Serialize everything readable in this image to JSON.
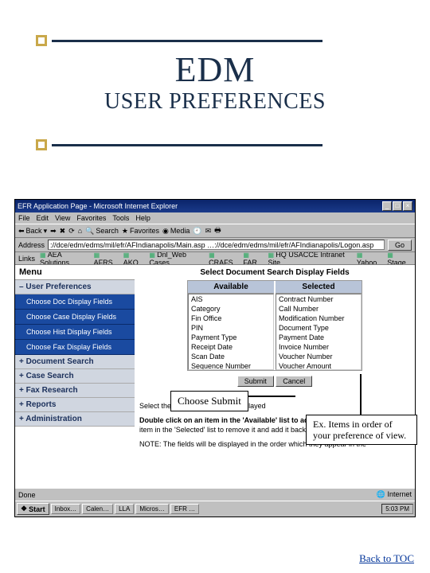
{
  "slide": {
    "title_main": "EDM",
    "title_sub": "USER PREFERENCES",
    "back_link": "Back to TOC"
  },
  "browser": {
    "window_title": "EFR Application Page - Microsoft Internet Explorer",
    "menus": [
      "File",
      "Edit",
      "View",
      "Favorites",
      "Tools",
      "Help"
    ],
    "toolbar": {
      "back": "Back",
      "search": "Search",
      "favorites": "Favorites",
      "media": "Media"
    },
    "address_label": "Address",
    "address_value": "://dce/edm/edms/mil/efr/AFIndianapolis/Main.asp …://dce/edm/edms/mil/efr/AFIndianapolis/Logon.asp",
    "go_label": "Go",
    "links_label": "Links",
    "links": [
      "AEA Solutions",
      "AFRS",
      "AKO",
      "Dnl_Web Cases",
      "CRAFS",
      "FAR",
      "HQ USACCE Intranet Site",
      "Yahoo",
      "Stage"
    ],
    "status_done": "Done",
    "status_zone": "Internet"
  },
  "sidebar": {
    "menu_header": "Menu",
    "groups": [
      {
        "label": "User Preferences",
        "open": true,
        "items": [
          "Choose Doc Display Fields",
          "Choose Case Display Fields",
          "Choose Hist Display Fields",
          "Choose Fax Display Fields"
        ]
      },
      {
        "label": "Document Search",
        "open": false
      },
      {
        "label": "Case Search",
        "open": false
      },
      {
        "label": "Fax Research",
        "open": false
      },
      {
        "label": "Reports",
        "open": false
      },
      {
        "label": "Administration",
        "open": false
      }
    ]
  },
  "panel": {
    "title": "Select Document Search Display Fields",
    "available_header": "Available",
    "selected_header": "Selected",
    "available": [
      "AIS",
      "Category",
      "Fin Office",
      "PIN",
      "Payment Type",
      "Receipt Date",
      "Scan Date",
      "Sequence Number"
    ],
    "selected": [
      "Contract Number",
      "Call Number",
      "Modification Number",
      "Document Type",
      "Payment Date",
      "Invoice Number",
      "Voucher Number",
      "Voucher Amount"
    ],
    "submit_label": "Submit",
    "cancel_label": "Cancel",
    "instruction1": "Select the desired fields to be displayed",
    "instruction2_bold": "Double click on an item in the 'Available' list to add it to the 'Selected' list.",
    "instruction2_rest": " on an item in the 'Selected' list to remove it and add it back to the 'Available' list.",
    "note_prefix": "NOTE: The fields will be displayed in the order which they appear in the '"
  },
  "callouts": {
    "choose_submit": "Choose Submit",
    "order_text": "Ex. Items in order of your preference of view."
  },
  "taskbar": {
    "start": "Start",
    "tasks": [
      "Inbox…",
      "Calen…",
      "LLA",
      "Micros…",
      "EFR …"
    ],
    "time": "5:03 PM"
  }
}
